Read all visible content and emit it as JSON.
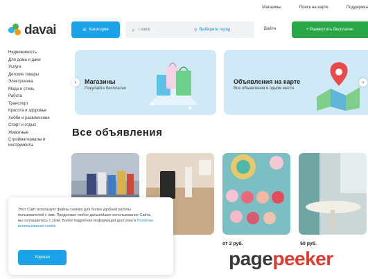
{
  "topnav": [
    "Магазины",
    "Поиск на карте",
    "Поддержка"
  ],
  "logo": {
    "text": "davai"
  },
  "header": {
    "categories_label": "Категории",
    "search_placeholder": "Поиск",
    "city_label": "Выберите город",
    "login_label": "Войти",
    "post_label": "+ Разместить бесплатно"
  },
  "sidebar": {
    "items": [
      "Недвижимость",
      "Для дома и дачи",
      "Услуги",
      "Детские товары",
      "Электроника",
      "Мода и стиль",
      "Работа",
      "Транспорт",
      "Красота и здоровье",
      "Хобби и развлечения",
      "Спорт и отдых",
      "Животные",
      "Стройматериалы и инструменты"
    ]
  },
  "banners": [
    {
      "title": "Магазины",
      "subtitle": "Покупайте бесплатно"
    },
    {
      "title": "Объявления на карте",
      "subtitle": "Все объявления в одном месте"
    }
  ],
  "section_title": "Все объявления",
  "cards": [
    {
      "price": "",
      "meta": ""
    },
    {
      "price": "",
      "meta": ""
    },
    {
      "price": "от 2 руб.",
      "meta": ""
    },
    {
      "price": "50 руб.",
      "meta": ""
    }
  ],
  "cookie": {
    "text": "Этот Сайт использует файлы cookies для более удобной работы пользователей с ним. Продолжая любое дальнейшее использование Сайта, вы соглашаетесь с этим. Более подробная информация доступна в",
    "link": "Политике использования cookie",
    "button": "Хорошо"
  },
  "watermark": {
    "part1": "page",
    "part2": "peeker"
  },
  "colors": {
    "accent_blue": "#1aa3e8",
    "green": "#27a745",
    "banner_bg": "#cfe9f7",
    "watermark_red": "#e23a2e"
  }
}
